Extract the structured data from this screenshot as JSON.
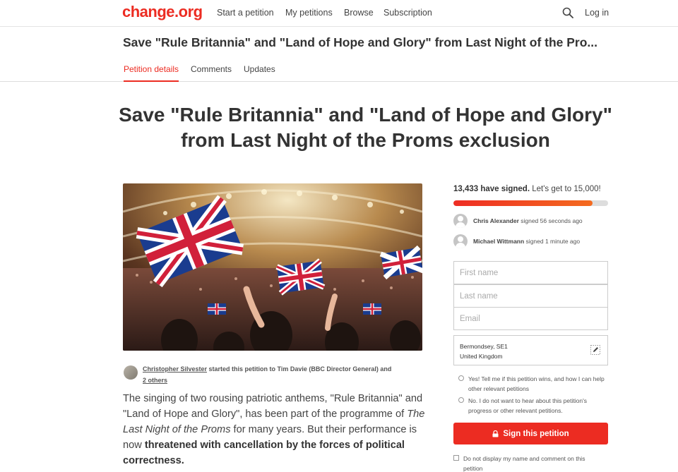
{
  "nav": {
    "logo": "change.org",
    "links": [
      "Start a petition",
      "My petitions",
      "Browse",
      "Subscription"
    ],
    "login": "Log in"
  },
  "titlebar": {
    "title": "Save \"Rule Britannia\" and \"Land of Hope and Glory\" from Last Night of the Pro...",
    "tabs": [
      "Petition details",
      "Comments",
      "Updates"
    ],
    "active_tab": "Petition details"
  },
  "headline": {
    "line1": "Save \"Rule Britannia\" and \"Land of Hope and Glory\"",
    "line2": "from Last Night of the Proms exclusion"
  },
  "starter": {
    "name": "Christopher Silvester",
    "middle": " started this petition to Tim Davie (BBC Director General) and",
    "others": "2 others"
  },
  "story": {
    "p1": "The singing of two rousing patriotic anthems, \"Rule Britannia\" and \"Land of Hope and Glory\", has been part of the programme of ",
    "p1_italic": "The Last Night of the Proms",
    "p1_mid": " for many years. But their performance is now ",
    "p1_bold": "threatened with cancellation by the forces of political correctness."
  },
  "signatures": {
    "count_text": "13,433 have signed.",
    "goal_text": " Let's get to 15,000!",
    "progress_fraction": 0.9,
    "recent": [
      {
        "name": "Chris Alexander",
        "when": " signed 56 seconds ago"
      },
      {
        "name": "Michael Wittmann",
        "when": " signed 1 minute ago"
      }
    ]
  },
  "form": {
    "first_name_placeholder": "First name",
    "last_name_placeholder": "Last name",
    "email_placeholder": "Email",
    "location_line1": "Bermondsey, SE1",
    "location_line2": "United Kingdom",
    "opt_in_yes": "Yes! Tell me if this petition wins, and how I can help other relevant petitions",
    "opt_in_no": "No. I do not want to hear about this petition's progress or other relevant petitions.",
    "sign_button": "Sign this petition",
    "hide_name": "Do not display my name and comment on this petition"
  },
  "colors": {
    "brand_red": "#ec2c22",
    "progress_orange": "#f46b1f"
  }
}
